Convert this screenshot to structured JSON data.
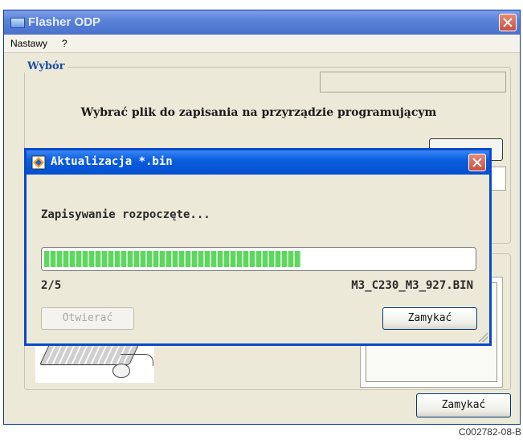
{
  "main_window": {
    "title": "Flasher ODP",
    "menu": {
      "settings": "Nastawy",
      "help": "?"
    },
    "group_label": "Wybór",
    "instruction": "Wybrać plik do zapisania na przyrządzie programującym",
    "close_button": "Zamykać"
  },
  "dialog": {
    "title": "Aktualizacja *.bin",
    "status": "Zapisywanie rozpoczęte...",
    "progress": 0.6,
    "counter": "2/5",
    "filename": "M3_C230_M3_927.BIN",
    "open_button": "Otwierać",
    "close_button": "Zamykać"
  },
  "reference_code": "C002782-08-B",
  "colors": {
    "titlebar_main": "#5a82d8",
    "titlebar_dialog": "#0a5ee0",
    "progress_fill": "#5fd65f",
    "group_label": "#1a4fa8"
  }
}
